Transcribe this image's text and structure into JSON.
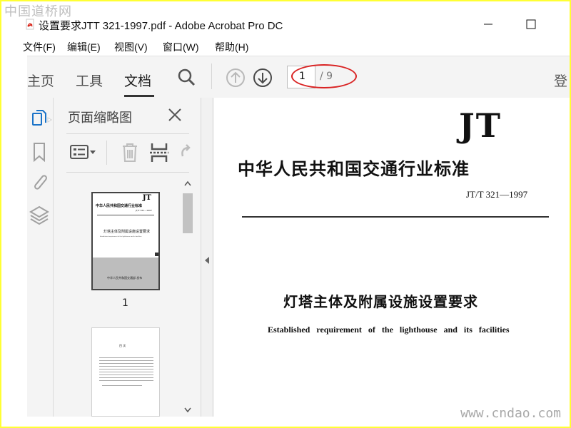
{
  "watermark": {
    "site_cn": "中国道桥网",
    "site_url": "www.cndao.com"
  },
  "window": {
    "title": "设置要求JTT 321-1997.pdf - Adobe Acrobat Pro DC"
  },
  "menu": {
    "items": [
      "文件(F)",
      "编辑(E)",
      "视图(V)",
      "窗口(W)",
      "帮助(H)"
    ]
  },
  "toolbar": {
    "tabs": [
      "主页",
      "工具",
      "文档"
    ],
    "active_tab": "文档",
    "current_page": "1",
    "total_pages": "/ 9",
    "signin": "登"
  },
  "sidebar": {
    "panel_title": "页面缩略图",
    "thumbnails": [
      {
        "page_label": "1",
        "logo": "JT",
        "header": "中华人民共和国交通行业标准",
        "code": "JT/T 321—1997",
        "title": "灯塔主体及附属设施设置要求",
        "subtitle": "Established requirement of the lighthouse and its facilities",
        "footer": "中华人民共和国交通部 发布"
      },
      {
        "page_label": "",
        "heading": "目 次"
      }
    ]
  },
  "document": {
    "logo": "JT",
    "org": "中华人民共和国交通行业标准",
    "code": "JT/T 321—1997",
    "title": "灯塔主体及附属设施设置要求",
    "subtitle": "Established requirement of the lighthouse and its facilities"
  },
  "colors": {
    "highlight_oval": "#d92323",
    "accent_blue": "#1a73c8",
    "outer_border": "#ffff33"
  }
}
